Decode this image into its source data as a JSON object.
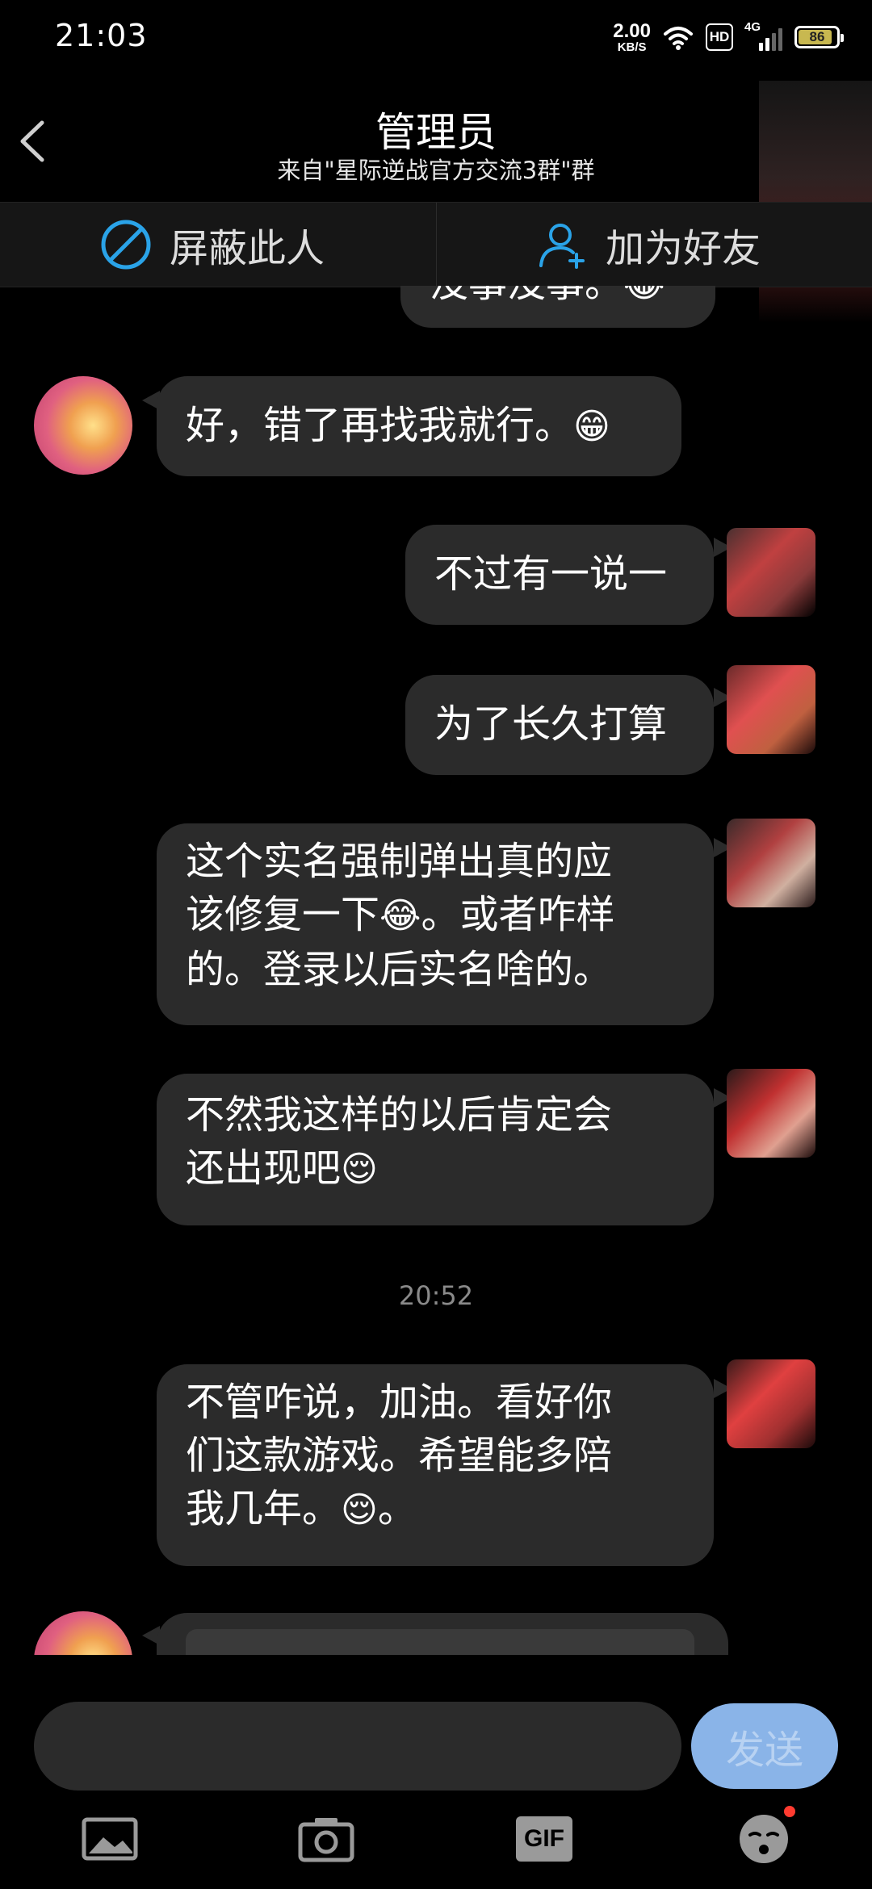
{
  "status_bar": {
    "time": "21:03",
    "speed_value": "2.00",
    "speed_unit": "KB/S",
    "hd": "HD",
    "network": "4G",
    "battery": "86"
  },
  "header": {
    "title": "管理员",
    "subtitle": "来自\"星际逆战官方交流3群\"群"
  },
  "actions": {
    "block_label": "屏蔽此人",
    "add_friend_label": "加为好友"
  },
  "messages": [
    {
      "side": "right",
      "text": "没事没事。",
      "emoji": "😂"
    },
    {
      "side": "left",
      "text": "好，错了再找我就行。",
      "emoji": "😁"
    },
    {
      "side": "right",
      "text": "不过有一说一"
    },
    {
      "side": "right",
      "text": "为了长久打算"
    },
    {
      "side": "right",
      "line1": "这个实名强制弹出真的应",
      "line2a": "该修复一下",
      "emoji": "😂",
      "line2b": "。或者咋样",
      "line3": "的。登录以后实名啥的。"
    },
    {
      "side": "right",
      "line1": "不然我这样的以后肯定会",
      "line2": "还出现吧",
      "emoji": "😌"
    },
    {
      "side": "right",
      "line1": "不管咋说，加油。看好你",
      "line2": "们这款游戏。希望能多陪",
      "line3": "我几年。",
      "emoji": "😌",
      "tail": "。"
    }
  ],
  "timestamp": "20:52",
  "composer": {
    "placeholder": "",
    "send_label": "发送"
  },
  "toolbar": {
    "gif_label": "GIF"
  },
  "colors": {
    "background": "#000000",
    "bubble": "#2b2b2b",
    "send_button": "#8ab4e8",
    "block_icon": "#2aa3e8"
  }
}
